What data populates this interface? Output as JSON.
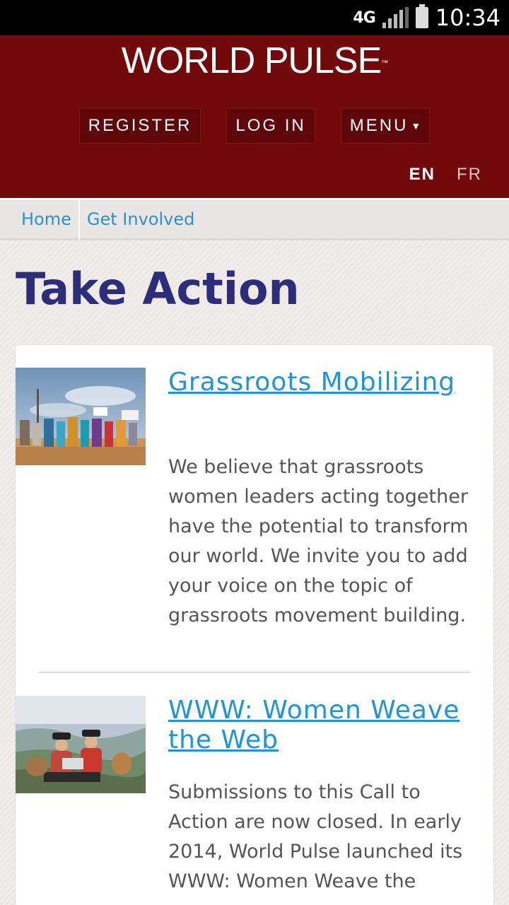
{
  "status_bar": {
    "network": "4G",
    "time": "10:34"
  },
  "header": {
    "logo": "WORLD PULSE",
    "trademark": "™",
    "nav": {
      "register": "REGISTER",
      "login": "LOG IN",
      "menu": "MENU"
    },
    "languages": {
      "en": "EN",
      "fr": "FR"
    }
  },
  "breadcrumb": {
    "home": "Home",
    "current": "Get Involved"
  },
  "page_title": "Take Action",
  "items": [
    {
      "title": "Grassroots Mobilizing",
      "description": "We believe that grassroots women leaders acting together have the potential to transform our world.  We invite you to add your voice on the topic of grassroots movement building."
    },
    {
      "title": "WWW: Women Weave the Web",
      "description": "Submissions to this Call to Action are now closed. In early 2014, World Pulse launched its WWW: Women Weave the"
    }
  ],
  "colors": {
    "header_bg": "#720a0c",
    "title": "#2c2e7c",
    "link": "#1f95d6"
  }
}
